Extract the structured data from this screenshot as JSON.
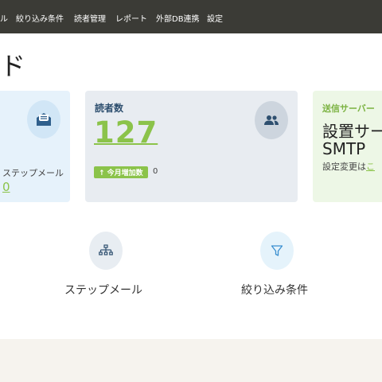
{
  "nav": {
    "items": [
      "ル",
      "絞り込み条件",
      "読者管理",
      "レポート",
      "外部DB連携",
      "設定"
    ]
  },
  "page": {
    "title": "ド"
  },
  "mail_card": {
    "icon": "envelope-icon",
    "label": "ステップメール",
    "count": "0"
  },
  "readers_card": {
    "icon": "people-icon",
    "title": "読者数",
    "count": "127",
    "month_badge": "↑ 今月増加数",
    "month_count": "0"
  },
  "server_card": {
    "title": "送信サーバー",
    "line1": "設置サー",
    "line2": "SMTP",
    "note": "設定変更は",
    "link": "こ"
  },
  "features": {
    "step": {
      "icon": "sitemap-icon",
      "label": "ステップメール"
    },
    "filter": {
      "icon": "filter-icon",
      "label": "絞り込み条件"
    }
  },
  "colors": {
    "topbar": "#3b3b36",
    "accent_green": "#8bc34a",
    "readers_title": "#2e4f6f",
    "mail_card_bg": "#e6f2fb",
    "readers_card_bg": "#e8ecf1",
    "server_card_bg": "#edf7e6"
  }
}
